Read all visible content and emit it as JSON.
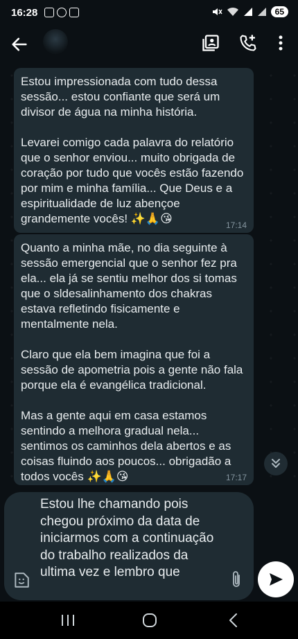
{
  "status_bar": {
    "time": "16:28",
    "battery": "65",
    "icons": [
      "screenshot-icon",
      "whatsapp-icon",
      "app-icon",
      "mute-icon",
      "wifi-icon",
      "signal-icon",
      "signal-icon"
    ]
  },
  "appbar": {
    "back_icon": "arrow-left-icon",
    "actions": [
      "contact-card-icon",
      "add-call-icon",
      "more-vert-icon"
    ]
  },
  "messages": [
    {
      "text": "Estou impressionada com tudo dessa sessão... estou confiante que será um divisor de água na minha história.\n\nLevarei comigo cada palavra do relatório que o senhor enviou... muito obrigada de coração por tudo que vocês estão fazendo por mim e minha família... Que Deus e a espiritualidade de luz abençoe grandemente vocês! ✨🙏😘",
      "time": "17:14"
    },
    {
      "text": "Quanto a minha mãe, no dia seguinte à sessão emergencial que o senhor fez pra ela... ela já se sentiu melhor dos si tomas que o sldesalinhamento dos chakras estava refletindo fisicamente e mentalmente nela.\n\nClaro que ela bem imagina que foi a sessão de apometria pois a gente não fala porque ela é evangélica tradicional.\n\nMas a gente aqui em casa estamos sentindo a melhora gradual nela... sentimos os caminhos dela abertos e as coisas fluindo aos poucos... obrigadão a todos vocês ✨🙏😘",
      "time": "17:17"
    }
  ],
  "composer": {
    "text": "Estou lhe chamando pois chegou próximo da data de iniciarmos com a continuação do trabalho realizados da ultima vez e lembro que"
  },
  "colors": {
    "background": "#0b1014",
    "bubble": "#1f2c33",
    "text": "#e9edef",
    "meta": "#8696a0"
  }
}
